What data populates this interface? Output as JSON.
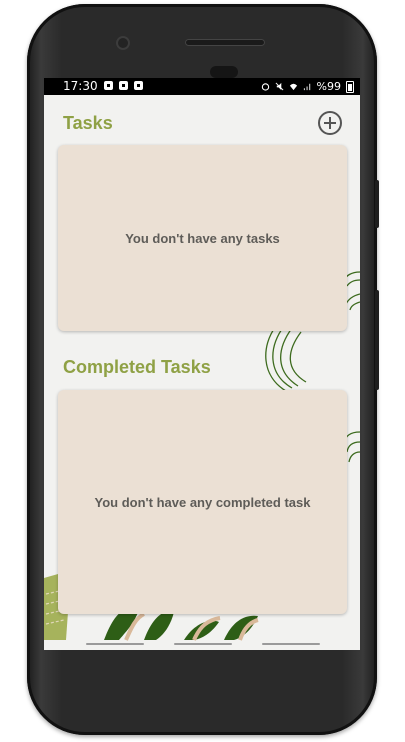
{
  "status_bar": {
    "time": "17:30",
    "battery": "%99"
  },
  "tasks_section": {
    "title": "Tasks",
    "empty_message": "You don't have any tasks",
    "add_icon": "add-circle-icon"
  },
  "completed_section": {
    "title": "Completed Tasks",
    "empty_message": "You don't have any completed task"
  },
  "colors": {
    "accent": "#8fa145",
    "card": "#ebe0d4",
    "background": "#f2f2f0",
    "deco_green": "#3d6b1e"
  }
}
